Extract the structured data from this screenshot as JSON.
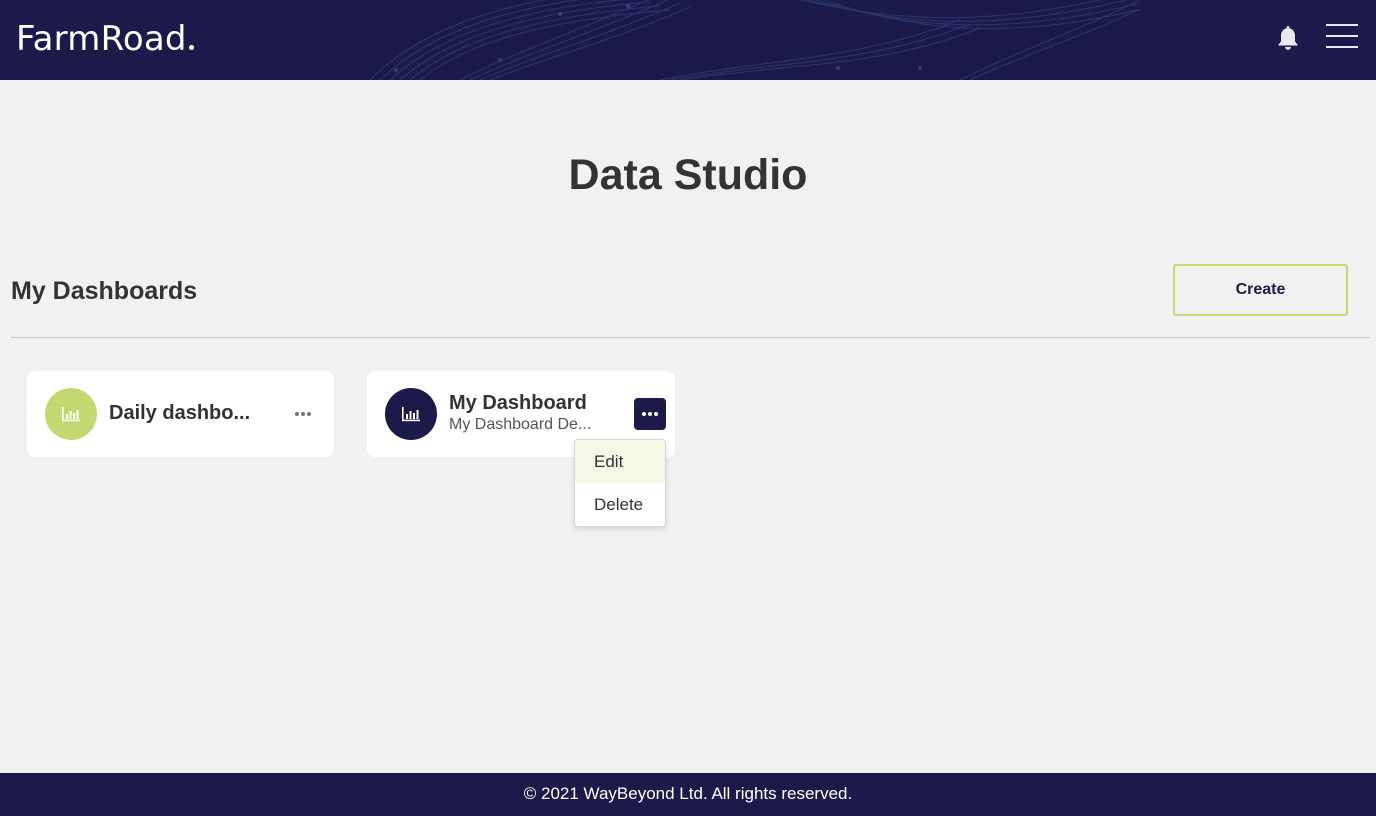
{
  "header": {
    "logo_text": "FarmRoad",
    "bell_icon": "bell-icon",
    "menu_icon": "hamburger-menu-icon"
  },
  "page": {
    "title": "Data Studio"
  },
  "dashboards": {
    "section_title": "My Dashboards",
    "create_label": "Create",
    "cards": [
      {
        "title": "Daily dashbo...",
        "subtitle": "",
        "avatar_color": "#c3d870",
        "icon": "bar-chart-icon"
      },
      {
        "title": "My Dashboard",
        "subtitle": "My Dashboard De...",
        "avatar_color": "#1b1a4a",
        "icon": "bar-chart-icon"
      }
    ]
  },
  "context_menu": {
    "items": [
      {
        "label": "Edit"
      },
      {
        "label": "Delete"
      }
    ]
  },
  "footer": {
    "copyright": "© 2021 WayBeyond Ltd. All rights reserved."
  },
  "colors": {
    "brand_navy": "#1b1a4a",
    "accent_green": "#c3d870",
    "background": "#f1f1f1"
  }
}
